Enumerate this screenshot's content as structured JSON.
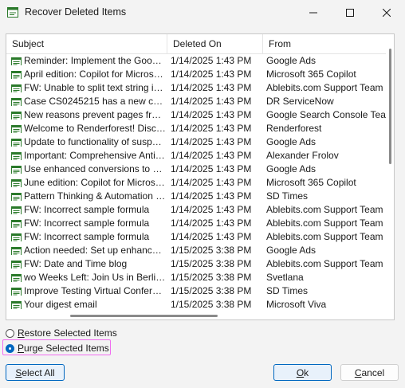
{
  "window": {
    "title": "Recover Deleted Items",
    "icon": "recover-items-icon",
    "controls": [
      "minimize-icon",
      "maximize-icon",
      "close-icon"
    ]
  },
  "list": {
    "columns": [
      "Subject",
      "Deleted On",
      "From"
    ],
    "rows": [
      {
        "subject": "Reminder: Implement the Google t...",
        "deleted_on": "1/14/2025 1:43 PM",
        "from": "Google Ads"
      },
      {
        "subject": "April edition: Copilot for Microsoft ...",
        "deleted_on": "1/14/2025 1:43 PM",
        "from": "Microsoft 365 Copilot"
      },
      {
        "subject": "FW: Unable to split text string in t...",
        "deleted_on": "1/14/2025 1:43 PM",
        "from": "Ablebits.com Support Team"
      },
      {
        "subject": "Case CS0245215 has a new comm...",
        "deleted_on": "1/14/2025 1:43 PM",
        "from": "DR ServiceNow"
      },
      {
        "subject": "New reasons prevent pages from ...",
        "deleted_on": "1/14/2025 1:43 PM",
        "from": "Google Search Console Team"
      },
      {
        "subject": "Welcome to Renderforest! Discov...",
        "deleted_on": "1/14/2025 1:43 PM",
        "from": "Renderforest"
      },
      {
        "subject": "Update to functionality of suspen...",
        "deleted_on": "1/14/2025 1:43 PM",
        "from": "Google Ads"
      },
      {
        "subject": "Important: Comprehensive Antivir...",
        "deleted_on": "1/14/2025 1:43 PM",
        "from": "Alexander Frolov"
      },
      {
        "subject": "Use enhanced conversions to pre...",
        "deleted_on": "1/14/2025 1:43 PM",
        "from": "Google Ads"
      },
      {
        "subject": "June edition: Copilot for Microsoft...",
        "deleted_on": "1/14/2025 1:43 PM",
        "from": "Microsoft 365 Copilot"
      },
      {
        "subject": "Pattern Thinking & Automation Val...",
        "deleted_on": "1/14/2025 1:43 PM",
        "from": "SD Times"
      },
      {
        "subject": "FW: Incorrect sample formula",
        "deleted_on": "1/14/2025 1:43 PM",
        "from": "Ablebits.com Support Team"
      },
      {
        "subject": "FW: Incorrect sample formula",
        "deleted_on": "1/14/2025 1:43 PM",
        "from": "Ablebits.com Support Team"
      },
      {
        "subject": "FW: Incorrect sample formula",
        "deleted_on": "1/14/2025 1:43 PM",
        "from": "Ablebits.com Support Team"
      },
      {
        "subject": "Action needed: Set up enhanced ...",
        "deleted_on": "1/15/2025 3:38 PM",
        "from": "Google Ads"
      },
      {
        "subject": "FW: Date and Time blog",
        "deleted_on": "1/15/2025 3:38 PM",
        "from": "Ablebits.com Support Team"
      },
      {
        "subject": "wo Weeks Left: Join Us in Berlin f...",
        "deleted_on": "1/15/2025 3:38 PM",
        "from": "Svetlana"
      },
      {
        "subject": "Improve Testing Virtual Conferenc...",
        "deleted_on": "1/15/2025 3:38 PM",
        "from": "SD Times"
      },
      {
        "subject": "Your digest email",
        "deleted_on": "1/15/2025 3:38 PM",
        "from": "Microsoft Viva"
      }
    ],
    "row_icon": "email-message-icon"
  },
  "options": {
    "restore_label": "Restore Selected Items",
    "purge_label": "Purge Selected Items",
    "selected": "purge",
    "highlight_color": "#f06cf0"
  },
  "buttons": {
    "select_all": "Select All",
    "ok": "Ok",
    "cancel": "Cancel"
  },
  "colors": {
    "accent": "#0067c0",
    "background": "#f3f3f3"
  }
}
